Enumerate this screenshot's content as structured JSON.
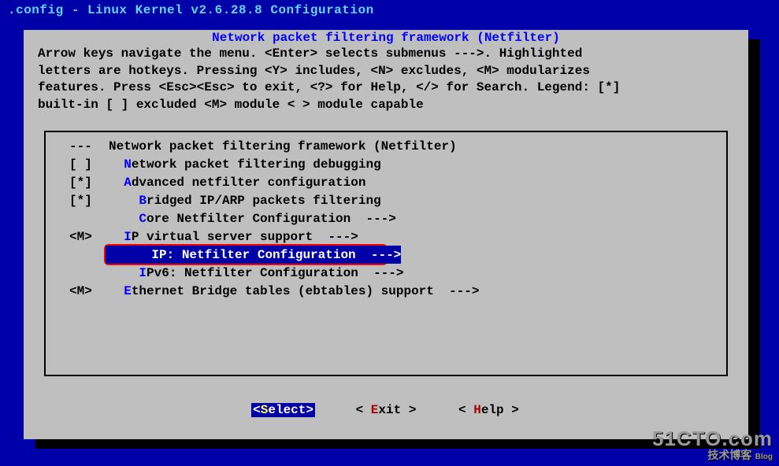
{
  "title_bar": ".config - Linux Kernel v2.6.28.8 Configuration",
  "dialog_title": "Network packet filtering framework (Netfilter)",
  "help_lines": [
    "Arrow keys navigate the menu.  <Enter> selects submenus --->.  Highlighted",
    "letters are hotkeys.  Pressing <Y> includes, <N> excludes, <M> modularizes",
    "features.  Press <Esc><Esc> to exit, <?> for Help, </> for Search.  Legend: [*]",
    "built-in  [ ] excluded  <M> module  < > module capable"
  ],
  "menu": [
    {
      "mark": "---",
      "pre": "",
      "hot": "",
      "rest": "Network packet filtering framework (Netfilter)",
      "arrow": ""
    },
    {
      "mark": "[ ]",
      "pre": "  ",
      "hot": "N",
      "rest": "etwork packet filtering debugging",
      "arrow": ""
    },
    {
      "mark": "[*]",
      "pre": "  ",
      "hot": "A",
      "rest": "dvanced netfilter configuration",
      "arrow": ""
    },
    {
      "mark": "[*]",
      "pre": "    ",
      "hot": "B",
      "rest": "ridged IP/ARP packets filtering",
      "arrow": ""
    },
    {
      "mark": "",
      "pre": "    ",
      "hot": "C",
      "rest": "ore Netfilter Configuration",
      "arrow": "  --->"
    },
    {
      "mark": "<M>",
      "pre": "  ",
      "hot": "I",
      "rest": "P virtual server support",
      "arrow": "  --->"
    },
    {
      "mark": "",
      "pre": "    ",
      "hot": "I",
      "rest": "P: Netfilter Configuration",
      "arrow": "  --->",
      "selected": true
    },
    {
      "mark": "",
      "pre": "    ",
      "hot": "I",
      "rest": "Pv6: Netfilter Configuration",
      "arrow": "  --->"
    },
    {
      "mark": "<M>",
      "pre": "  ",
      "hot": "E",
      "rest": "thernet Bridge tables (ebtables) support",
      "arrow": "  --->"
    }
  ],
  "buttons": {
    "select": {
      "open": "<",
      "hot": "S",
      "rest": "elect",
      "close": ">"
    },
    "exit": {
      "open": "< ",
      "hot": "E",
      "rest": "xit",
      "close": " >"
    },
    "help": {
      "open": "< ",
      "hot": "H",
      "rest": "elp",
      "close": " >"
    }
  },
  "watermark": {
    "big": "51CTO.com",
    "small": "技术博客",
    "tiny": "Blog"
  }
}
